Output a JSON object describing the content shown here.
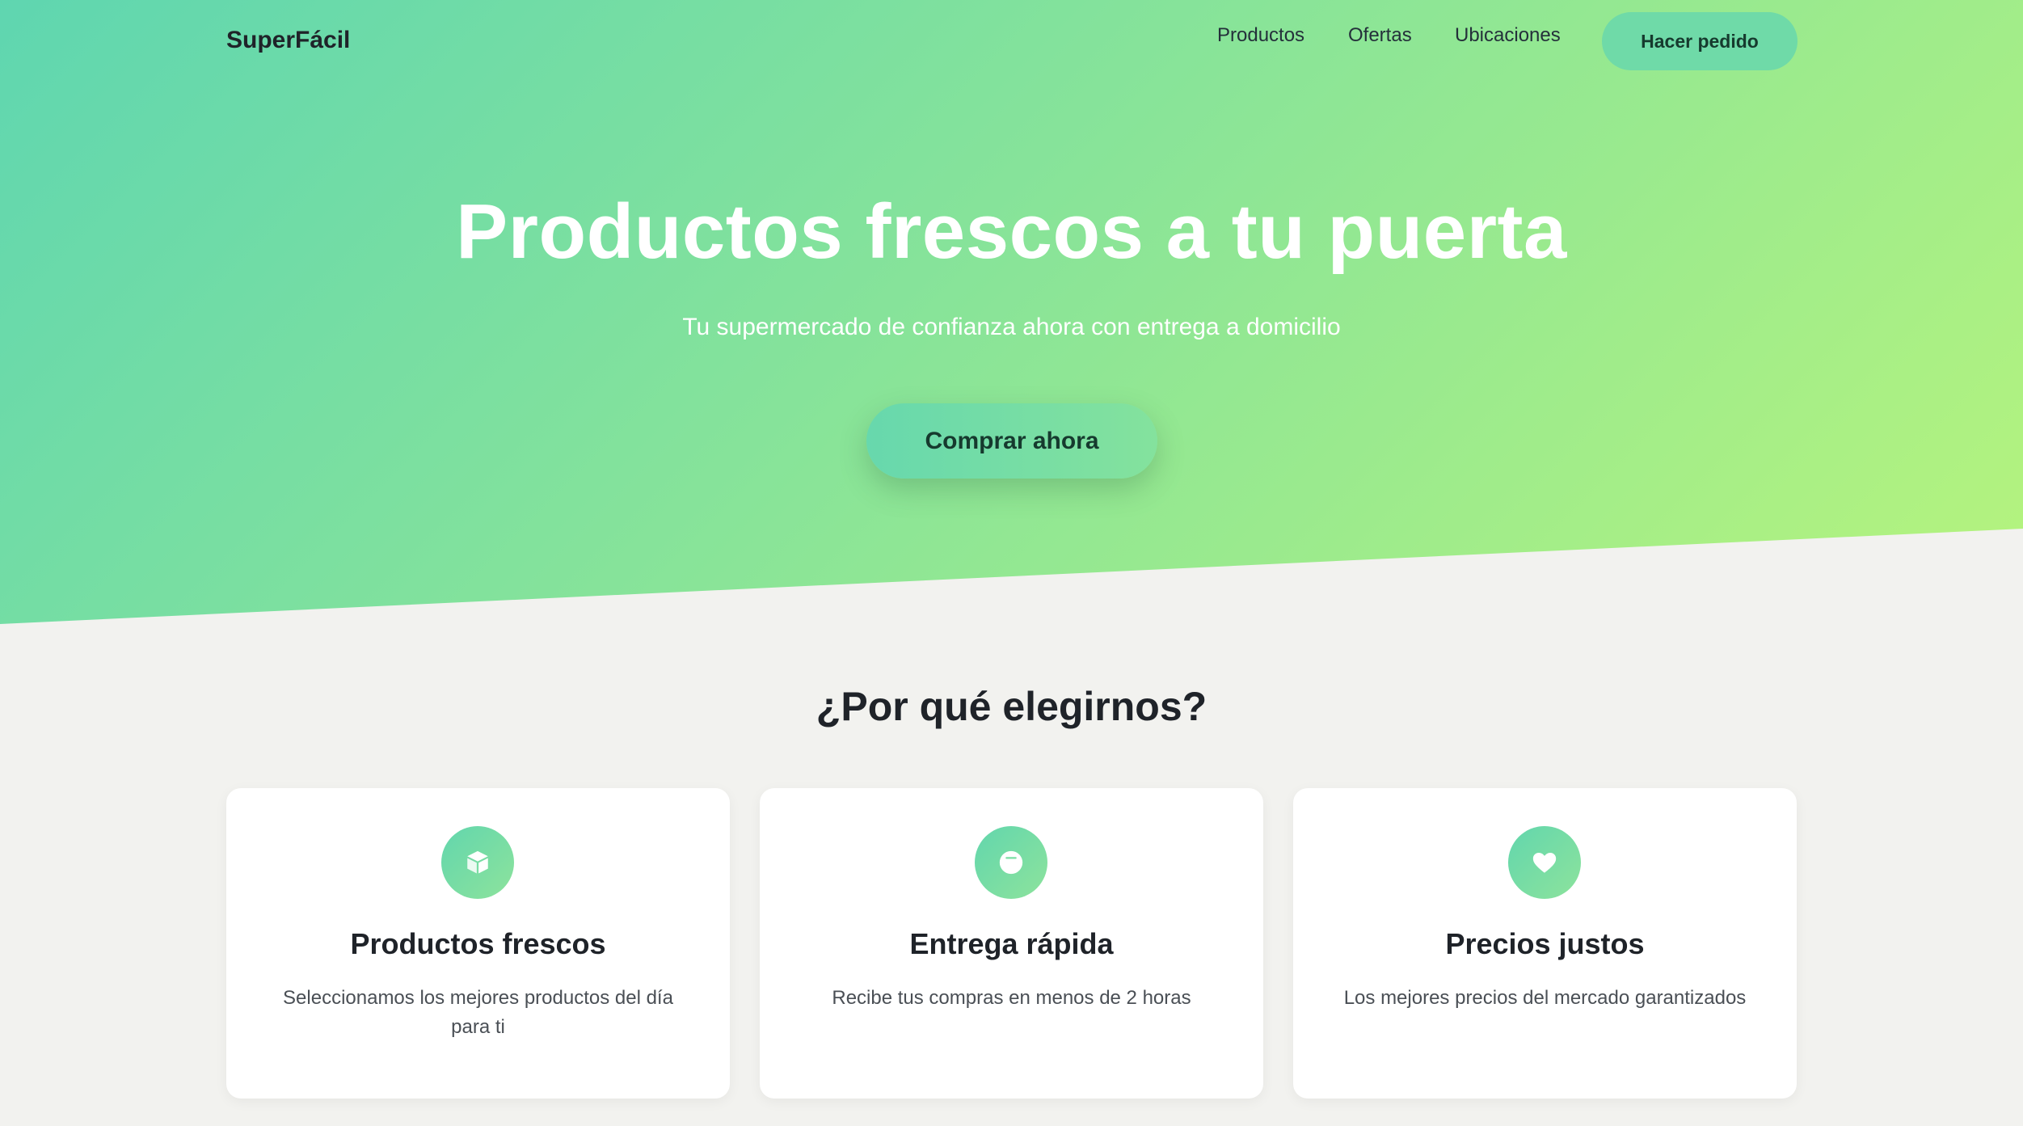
{
  "nav": {
    "brand": "SuperFácil",
    "links": [
      "Productos",
      "Ofertas",
      "Ubicaciones"
    ],
    "cta_label": "Hacer pedido"
  },
  "hero": {
    "title": "Productos frescos a tu puerta",
    "subtitle": "Tu supermercado de confianza ahora con entrega a domicilio",
    "cta_label": "Comprar ahora"
  },
  "features": {
    "title": "¿Por qué elegirnos?",
    "cards": [
      {
        "icon": "box-icon",
        "title": "Productos frescos",
        "description": "Seleccionamos los mejores productos del día para ti"
      },
      {
        "icon": "clock-icon",
        "title": "Entrega rápida",
        "description": "Recibe tus compras en menos de 2 horas"
      },
      {
        "icon": "heart-icon",
        "title": "Precios justos",
        "description": "Los mejores precios del mercado garantizados"
      }
    ]
  },
  "colors": {
    "gradient_start": "#5fd6b0",
    "gradient_end": "#b6f47d",
    "page_background": "#f2f2ef",
    "text_dark": "#1f2329"
  }
}
